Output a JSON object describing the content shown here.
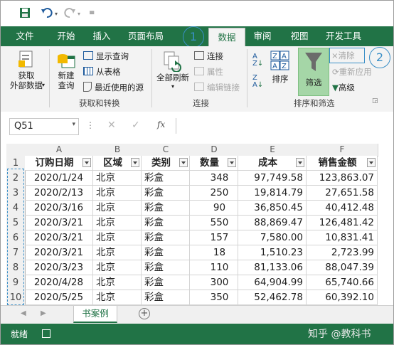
{
  "qat": {
    "save": "save-icon",
    "undo": "undo-icon",
    "redo": "redo-icon"
  },
  "tabs": [
    {
      "label": "文件"
    },
    {
      "label": "开始"
    },
    {
      "label": "插入"
    },
    {
      "label": "页面布局"
    },
    {
      "label": "数据"
    },
    {
      "label": "审阅"
    },
    {
      "label": "视图"
    },
    {
      "label": "开发工具"
    }
  ],
  "callouts": {
    "one": "1",
    "two": "2"
  },
  "ribbon": {
    "get_external": "获取\n外部数据",
    "new_query": "新建\n查询",
    "show_query": "显示查询",
    "from_table": "从表格",
    "recent_sources": "最近使用的源",
    "group_get": "获取和转换",
    "refresh_all": "全部刷新",
    "connections": "连接",
    "properties": "属性",
    "edit_links": "编辑链接",
    "group_conn": "连接",
    "sort": "排序",
    "filter": "筛选",
    "clear": "清除",
    "reapply": "重新应用",
    "advanced": "高级",
    "group_sort": "排序和筛选"
  },
  "formula_bar": {
    "name_box": "Q51",
    "fx": "fx"
  },
  "columns": [
    "A",
    "B",
    "C",
    "D",
    "E",
    "F"
  ],
  "headers": [
    "订购日期",
    "区域",
    "类别",
    "数量",
    "成本",
    "销售金额"
  ],
  "rows": [
    [
      "2020/1/24",
      "北京",
      "彩盒",
      "348",
      "97,749.58",
      "123,863.07"
    ],
    [
      "2020/2/13",
      "北京",
      "彩盒",
      "250",
      "19,814.79",
      "27,651.58"
    ],
    [
      "2020/3/16",
      "北京",
      "彩盒",
      "90",
      "36,850.45",
      "40,412.48"
    ],
    [
      "2020/3/21",
      "北京",
      "彩盒",
      "550",
      "88,869.47",
      "126,481.42"
    ],
    [
      "2020/3/21",
      "北京",
      "彩盒",
      "157",
      "7,580.00",
      "10,831.41"
    ],
    [
      "2020/3/21",
      "北京",
      "彩盒",
      "18",
      "1,510.23",
      "2,723.99"
    ],
    [
      "2020/3/23",
      "北京",
      "彩盒",
      "110",
      "81,133.06",
      "88,047.39"
    ],
    [
      "2020/4/28",
      "北京",
      "彩盒",
      "300",
      "64,904.99",
      "65,740.66"
    ],
    [
      "2020/5/25",
      "北京",
      "彩盒",
      "350",
      "52,462.78",
      "60,392.10"
    ]
  ],
  "row_numbers": [
    "1",
    "2",
    "3",
    "4",
    "5",
    "6",
    "7",
    "8",
    "9",
    "10"
  ],
  "sheet_tab": "书案例",
  "status_ready": "就绪",
  "watermark": "知乎 @教科书",
  "colors": {
    "excel_green": "#217346",
    "callout_blue": "#3a8fc7",
    "filter_hl": "#a5d6a7"
  }
}
